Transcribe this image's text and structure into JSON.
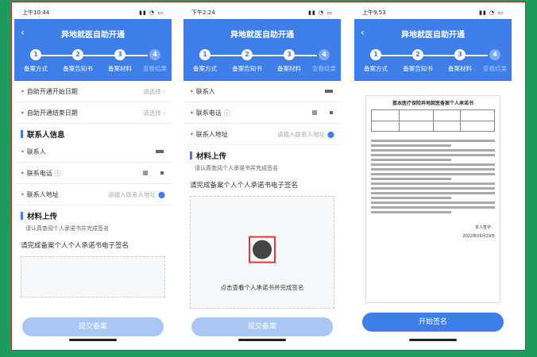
{
  "screens": [
    {
      "time": "上午10:44",
      "title": "异地就医自助开通",
      "steps": [
        {
          "num": "1",
          "label": "备案方式",
          "done": true
        },
        {
          "num": "2",
          "label": "备案告知书",
          "done": true
        },
        {
          "num": "3",
          "label": "备案材料",
          "done": true
        },
        {
          "num": "4",
          "label": "查看结果",
          "done": false
        }
      ],
      "start_date": {
        "label": "自助开通开始日期",
        "placeholder": "请选择"
      },
      "end_date": {
        "label": "自助开通结束日期",
        "placeholder": "请选择"
      },
      "contact_section": "联系人信息",
      "contact_label": "联系人",
      "phone_label": "联系电话",
      "address_label": "联系人地址",
      "address_placeholder": "请输入联系人地址",
      "material_section": "材料上传",
      "material_hint": "请认真查阅个人承诺书并完成签名",
      "sign_prompt": "请完成备案个人个人承诺书电子签名",
      "submit": "提交备案"
    },
    {
      "time": "下午2:24",
      "title": "异地就医自助开通",
      "steps": [
        {
          "num": "1",
          "label": "备案方式",
          "done": true
        },
        {
          "num": "2",
          "label": "备案告知书",
          "done": true
        },
        {
          "num": "3",
          "label": "备案材料",
          "done": true
        },
        {
          "num": "4",
          "label": "查看结果",
          "done": false
        }
      ],
      "contact_label": "联系人",
      "phone_label": "联系电话",
      "address_label": "联系人地址",
      "address_placeholder": "请输入联系人地址",
      "material_section": "材料上传",
      "material_hint": "请认真查阅个人承诺书并完成签名",
      "sign_prompt": "请完成备案个人个人承诺书电子签名",
      "view_sign": "点击查看个人承诺书并完成签名",
      "submit": "提交备案"
    },
    {
      "time": "上午9:53",
      "title": "异地就医自助开通",
      "steps": [
        {
          "num": "1",
          "label": "备案方式",
          "done": true
        },
        {
          "num": "2",
          "label": "备案告知书",
          "done": true
        },
        {
          "num": "3",
          "label": "备案材料",
          "done": true
        },
        {
          "num": "4",
          "label": "查看结果",
          "done": false
        }
      ],
      "doc_title": "基本医疗保险异地就医备案个人承诺书",
      "doc_signer": "本人签字：",
      "doc_date": "2022年05月29日",
      "start_sign": "开始签名"
    }
  ]
}
